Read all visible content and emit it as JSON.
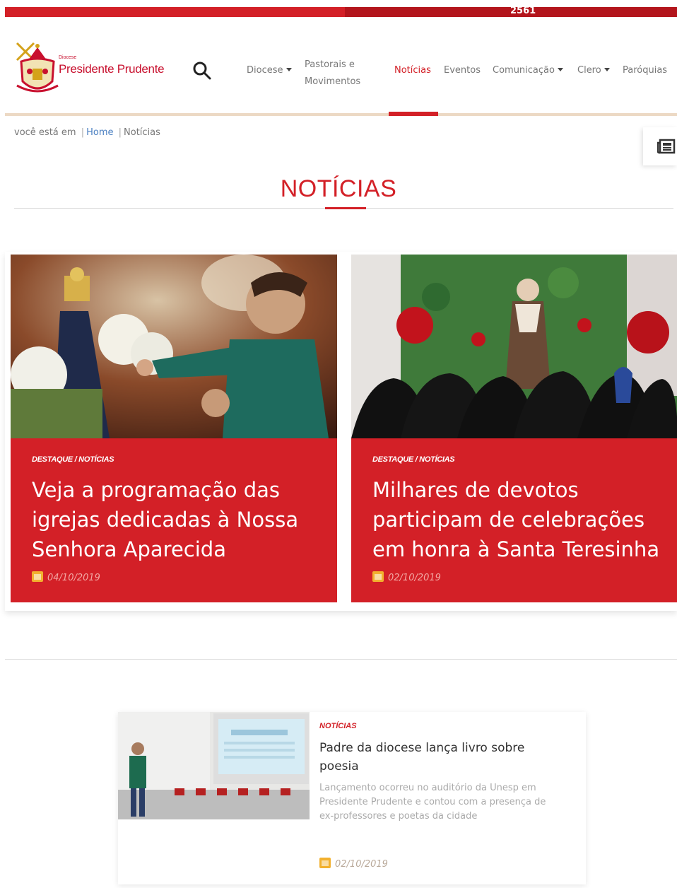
{
  "topbar": {
    "number": "2561"
  },
  "logo": {
    "small_text": "Diocese",
    "name": "Presidente Prudente"
  },
  "nav": {
    "items": [
      {
        "label": "Diocese",
        "dropdown": true
      },
      {
        "label_line1": "Pastorais e",
        "label_line2": "Movimentos"
      },
      {
        "label": "Notícias",
        "active": true
      },
      {
        "label": "Eventos"
      },
      {
        "label": "Comunicação",
        "dropdown": true
      },
      {
        "label": "Clero",
        "dropdown": true
      },
      {
        "label": "Paróquias"
      }
    ]
  },
  "breadcrumb": {
    "prefix": "você está em",
    "separator": "|",
    "home": "Home",
    "current": "Notícias"
  },
  "page": {
    "title": "NOTÍCIAS"
  },
  "featured": [
    {
      "category": "DESTAQUE / NOTÍCIAS",
      "title": "Veja a programação das igrejas dedicadas à Nossa Senhora Aparecida",
      "date": "04/10/2019"
    },
    {
      "category": "DESTAQUE / NOTÍCIAS",
      "title": "Milhares de devotos participam de celebrações em honra à Santa Teresinha",
      "date": "02/10/2019"
    }
  ],
  "list": [
    {
      "category": "NOTÍCIAS",
      "title": "Padre da diocese lança livro sobre poesia",
      "excerpt": "Lançamento ocorreu no auditório da Unesp em Presidente Prudente e contou com a presença de ex-professores e poetas da cidade",
      "date": "02/10/2019"
    }
  ],
  "colors": {
    "brand_red": "#d32027",
    "dark_red": "#b3151c",
    "calendar_icon": "#f2b12f",
    "link_blue": "#4a7fc1"
  },
  "icons": {
    "search": "search-icon",
    "side_tab": "newspaper-icon",
    "date": "calendar-icon",
    "dropdown": "caret-down-icon"
  }
}
